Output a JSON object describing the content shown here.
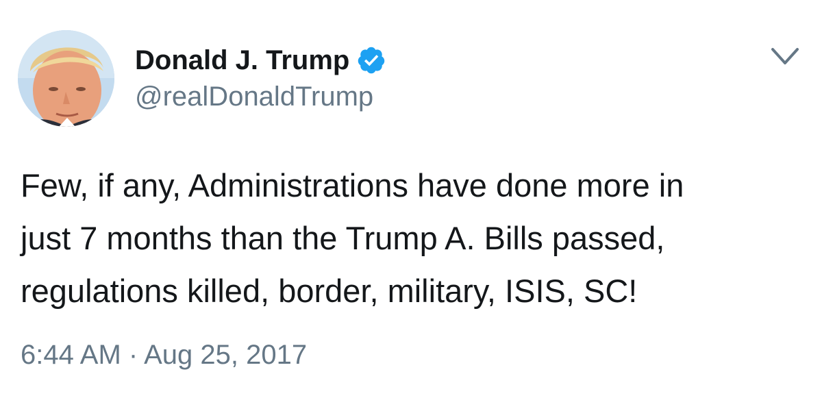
{
  "tweet": {
    "author": {
      "display_name": "Donald J. Trump",
      "handle": "@realDonaldTrump",
      "verified": true,
      "avatar_icon": "user-avatar-photo"
    },
    "menu_icon": "chevron-down-icon",
    "text_lines": [
      "Few, if any, Administrations have done more in",
      "just 7 months than the Trump A. Bills passed,",
      "regulations killed, border, military, ISIS, SC!"
    ],
    "timestamp": "6:44 AM · Aug 25, 2017"
  },
  "colors": {
    "text_primary": "#14171a",
    "text_secondary": "#657786",
    "verified_blue": "#1da1f2",
    "background": "#ffffff"
  }
}
